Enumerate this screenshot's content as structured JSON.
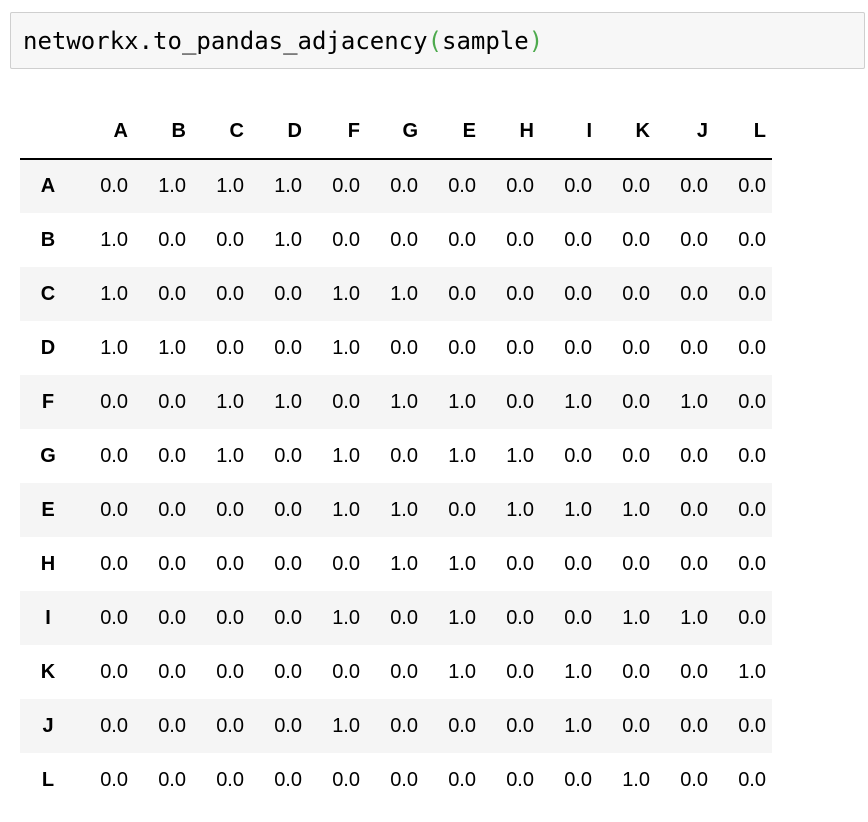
{
  "code_cell": {
    "function_text": "networkx.to_pandas_adjacency",
    "open_paren": "(",
    "argument": "sample",
    "close_paren": ")"
  },
  "dataframe": {
    "corner": "",
    "columns": [
      "A",
      "B",
      "C",
      "D",
      "F",
      "G",
      "E",
      "H",
      "I",
      "K",
      "J",
      "L"
    ],
    "rows": [
      {
        "label": "A",
        "values": [
          "0.0",
          "1.0",
          "1.0",
          "1.0",
          "0.0",
          "0.0",
          "0.0",
          "0.0",
          "0.0",
          "0.0",
          "0.0",
          "0.0"
        ]
      },
      {
        "label": "B",
        "values": [
          "1.0",
          "0.0",
          "0.0",
          "1.0",
          "0.0",
          "0.0",
          "0.0",
          "0.0",
          "0.0",
          "0.0",
          "0.0",
          "0.0"
        ]
      },
      {
        "label": "C",
        "values": [
          "1.0",
          "0.0",
          "0.0",
          "0.0",
          "1.0",
          "1.0",
          "0.0",
          "0.0",
          "0.0",
          "0.0",
          "0.0",
          "0.0"
        ]
      },
      {
        "label": "D",
        "values": [
          "1.0",
          "1.0",
          "0.0",
          "0.0",
          "1.0",
          "0.0",
          "0.0",
          "0.0",
          "0.0",
          "0.0",
          "0.0",
          "0.0"
        ]
      },
      {
        "label": "F",
        "values": [
          "0.0",
          "0.0",
          "1.0",
          "1.0",
          "0.0",
          "1.0",
          "1.0",
          "0.0",
          "1.0",
          "0.0",
          "1.0",
          "0.0"
        ]
      },
      {
        "label": "G",
        "values": [
          "0.0",
          "0.0",
          "1.0",
          "0.0",
          "1.0",
          "0.0",
          "1.0",
          "1.0",
          "0.0",
          "0.0",
          "0.0",
          "0.0"
        ]
      },
      {
        "label": "E",
        "values": [
          "0.0",
          "0.0",
          "0.0",
          "0.0",
          "1.0",
          "1.0",
          "0.0",
          "1.0",
          "1.0",
          "1.0",
          "0.0",
          "0.0"
        ]
      },
      {
        "label": "H",
        "values": [
          "0.0",
          "0.0",
          "0.0",
          "0.0",
          "0.0",
          "1.0",
          "1.0",
          "0.0",
          "0.0",
          "0.0",
          "0.0",
          "0.0"
        ]
      },
      {
        "label": "I",
        "values": [
          "0.0",
          "0.0",
          "0.0",
          "0.0",
          "1.0",
          "0.0",
          "1.0",
          "0.0",
          "0.0",
          "1.0",
          "1.0",
          "0.0"
        ]
      },
      {
        "label": "K",
        "values": [
          "0.0",
          "0.0",
          "0.0",
          "0.0",
          "0.0",
          "0.0",
          "1.0",
          "0.0",
          "1.0",
          "0.0",
          "0.0",
          "1.0"
        ]
      },
      {
        "label": "J",
        "values": [
          "0.0",
          "0.0",
          "0.0",
          "0.0",
          "1.0",
          "0.0",
          "0.0",
          "0.0",
          "1.0",
          "0.0",
          "0.0",
          "0.0"
        ]
      },
      {
        "label": "L",
        "values": [
          "0.0",
          "0.0",
          "0.0",
          "0.0",
          "0.0",
          "0.0",
          "0.0",
          "0.0",
          "0.0",
          "1.0",
          "0.0",
          "0.0"
        ]
      }
    ]
  },
  "colors": {
    "code_background": "#f7f7f7",
    "code_border": "#cfcfcf",
    "paren": "#4daa4d",
    "stripe": "#f5f5f5",
    "header_rule": "#000000"
  }
}
